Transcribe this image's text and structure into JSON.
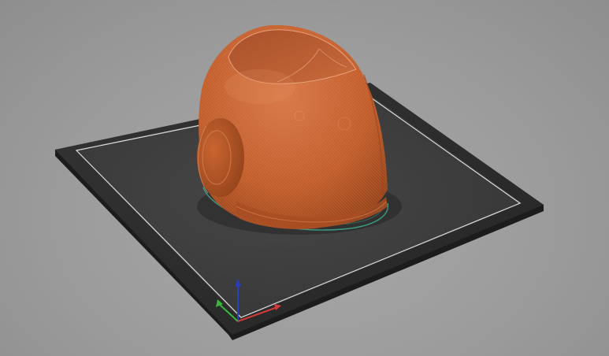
{
  "app": {
    "view": "3d-preview"
  },
  "scene": {
    "background_color": "#9c9c9c",
    "bed_color": "#2c2c2c",
    "bed_surface_color": "#3a3a3a",
    "bed_outline_color": "#d8d8d8",
    "model_color": "#c8632f",
    "model_shadow_color": "#8f3f17",
    "model_highlight_color": "#e08a55",
    "skirt_color": "#3fa58c",
    "axes": {
      "x_color": "#d03a3a",
      "y_color": "#3bb53b",
      "z_color": "#2a3fb8"
    }
  }
}
